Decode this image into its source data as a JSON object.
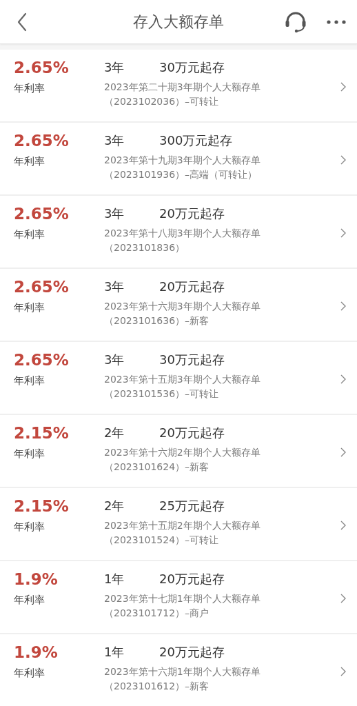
{
  "header": {
    "title": "存入大额存单"
  },
  "products": [
    {
      "rate": "2.65%",
      "rate_label": "年利率",
      "term": "3年",
      "min_amount": "30万元起存",
      "name": "2023年第二十期3年期个人大额存单",
      "code": "（2023102036）–可转让"
    },
    {
      "rate": "2.65%",
      "rate_label": "年利率",
      "term": "3年",
      "min_amount": "300万元起存",
      "name": "2023年第十九期3年期个人大额存单",
      "code": "（2023101936）–高端（可转让）"
    },
    {
      "rate": "2.65%",
      "rate_label": "年利率",
      "term": "3年",
      "min_amount": "20万元起存",
      "name": "2023年第十八期3年期个人大额存单",
      "code": "（2023101836）"
    },
    {
      "rate": "2.65%",
      "rate_label": "年利率",
      "term": "3年",
      "min_amount": "20万元起存",
      "name": "2023年第十六期3年期个人大额存单",
      "code": "（2023101636）–新客"
    },
    {
      "rate": "2.65%",
      "rate_label": "年利率",
      "term": "3年",
      "min_amount": "30万元起存",
      "name": "2023年第十五期3年期个人大额存单",
      "code": "（2023101536）–可转让"
    },
    {
      "rate": "2.15%",
      "rate_label": "年利率",
      "term": "2年",
      "min_amount": "20万元起存",
      "name": "2023年第十六期2年期个人大额存单",
      "code": "（2023101624）–新客"
    },
    {
      "rate": "2.15%",
      "rate_label": "年利率",
      "term": "2年",
      "min_amount": "25万元起存",
      "name": "2023年第十五期2年期个人大额存单",
      "code": "（2023101524）–可转让"
    },
    {
      "rate": "1.9%",
      "rate_label": "年利率",
      "term": "1年",
      "min_amount": "20万元起存",
      "name": "2023年第十七期1年期个人大额存单",
      "code": "（2023101712）–商户"
    },
    {
      "rate": "1.9%",
      "rate_label": "年利率",
      "term": "1年",
      "min_amount": "20万元起存",
      "name": "2023年第十六期1年期个人大额存单",
      "code": "（2023101612）–新客"
    }
  ]
}
